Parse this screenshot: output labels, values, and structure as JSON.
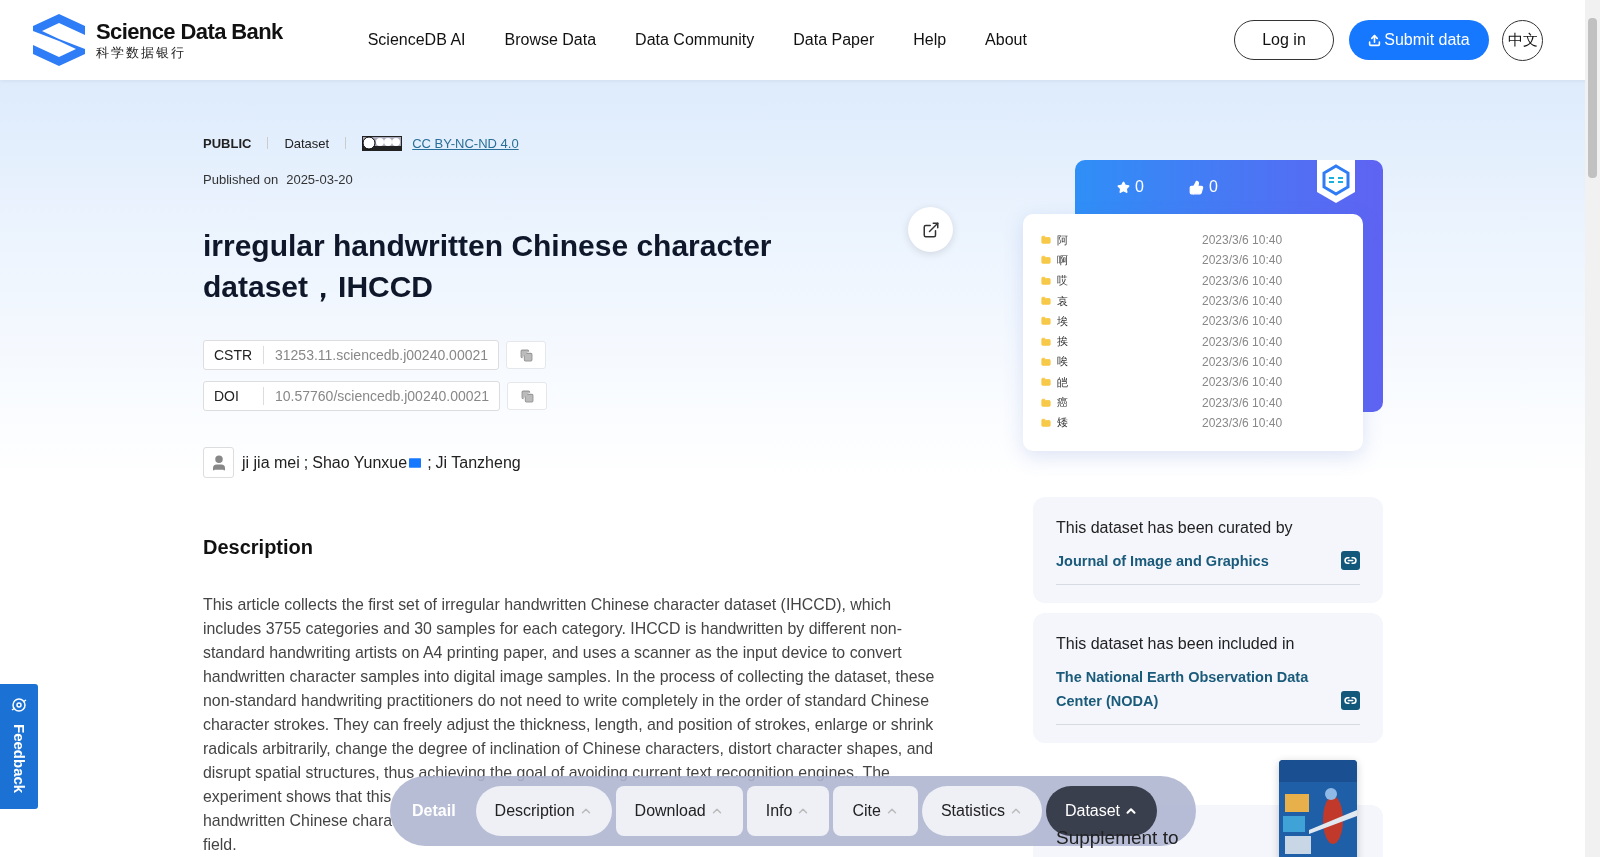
{
  "header": {
    "logo_title": "Science Data Bank",
    "logo_subtitle": "科学数据银行",
    "nav": [
      "ScienceDB AI",
      "Browse Data",
      "Data Community",
      "Data Paper",
      "Help",
      "About"
    ],
    "login": "Log in",
    "submit": "Submit data",
    "language": "中文"
  },
  "meta": {
    "access": "PUBLIC",
    "type": "Dataset",
    "license": "CC BY-NC-ND 4.0",
    "published_label": "Published on",
    "published_date": "2025-03-20"
  },
  "title": "irregular handwritten Chinese character dataset，IHCCD",
  "identifiers": [
    {
      "label": "CSTR",
      "value": "31253.11.sciencedb.j00240.00021"
    },
    {
      "label": "DOI",
      "value": "10.57760/sciencedb.j00240.00021"
    }
  ],
  "authors": [
    {
      "name": "ji jia mei",
      "email": false
    },
    {
      "name": "Shao Yunxue",
      "email": true
    },
    {
      "name": "Ji Tanzheng",
      "email": false
    }
  ],
  "author_separator": ";",
  "description": {
    "heading": "Description",
    "text": "This article collects the first set of irregular handwritten Chinese character dataset (IHCCD), which includes 3755 categories and 30 samples for each category. IHCCD is handwritten by different non-standard handwriting artists on A4 printing paper, and uses a scanner as the input device to convert handwritten character samples into digital image samples. In the process of collecting the dataset, these non-standard handwriting practitioners do not need to write completely in the order of standard Chinese character strokes. They can freely adjust the thickness, length, and position of strokes, enlarge or shrink radicals arbitrarily, change the degree of inclination of Chinese characters, distort character shapes, and disrupt spatial structures, thus achieving the goal of avoiding current text recognition engines. The",
    "covered_lines": [
      "experiment shows that this",
      "handwritten Chinese chara",
      "field."
    ]
  },
  "stats": {
    "favorites": "0",
    "likes": "0"
  },
  "files": [
    {
      "name": "阿",
      "date": "2023/3/6 10:40"
    },
    {
      "name": "啊",
      "date": "2023/3/6 10:40"
    },
    {
      "name": "哎",
      "date": "2023/3/6 10:40"
    },
    {
      "name": "哀",
      "date": "2023/3/6 10:40"
    },
    {
      "name": "埃",
      "date": "2023/3/6 10:40"
    },
    {
      "name": "挨",
      "date": "2023/3/6 10:40"
    },
    {
      "name": "唉",
      "date": "2023/3/6 10:40"
    },
    {
      "name": "皑",
      "date": "2023/3/6 10:40"
    },
    {
      "name": "癌",
      "date": "2023/3/6 10:40"
    },
    {
      "name": "矮",
      "date": "2023/3/6 10:40"
    }
  ],
  "relations": [
    {
      "heading": "This dataset has been curated by",
      "link": "Journal of Image and Graphics"
    },
    {
      "heading": "This dataset has been included in",
      "link": "The National Earth Observation Data Center (NODA)"
    }
  ],
  "supplement": {
    "heading": "Supplement to"
  },
  "detail_bar": {
    "label": "Detail",
    "tabs": [
      {
        "label": "Description",
        "selected": false
      },
      {
        "label": "Download",
        "selected": false
      },
      {
        "label": "Info",
        "selected": false
      },
      {
        "label": "Cite",
        "selected": false
      },
      {
        "label": "Statistics",
        "selected": false
      },
      {
        "label": "Dataset",
        "selected": true
      }
    ]
  },
  "feedback": "Feedback"
}
